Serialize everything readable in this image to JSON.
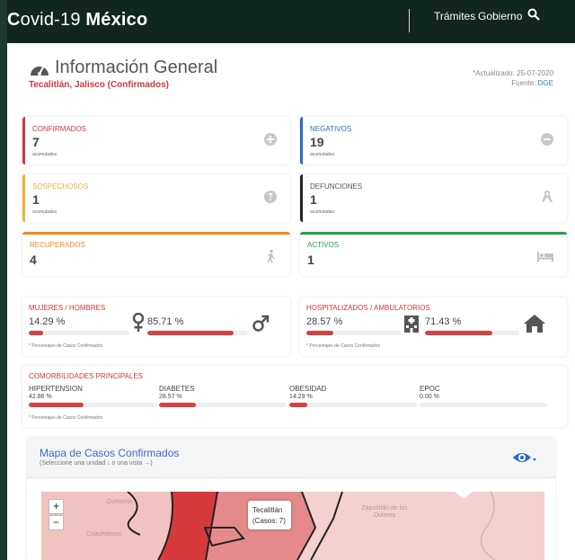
{
  "app": {
    "brand_prefix": "C",
    "brand_rest": "ovid-19 ",
    "brand_bold": "México",
    "nav": [
      "Trámites",
      "Gobierno"
    ]
  },
  "header": {
    "title": "Información General",
    "subtitle": "Tecalitlán, Jalisco (Confirmados)",
    "updated": "*Actualizado: 25-07-2020",
    "source_label": "Fuente:",
    "source_link": "DGE"
  },
  "cards": {
    "confirmados": {
      "label": "CONFIRMADOS",
      "value": "7",
      "note": "acumulados",
      "color": "#d2363b"
    },
    "negativos": {
      "label": "NEGATIVOS",
      "value": "19",
      "note": "acumulados",
      "color": "#2b6cc4"
    },
    "sospechosos": {
      "label": "SOSPECHOSOS",
      "value": "1",
      "note": "acumulados",
      "color": "#f2b13b"
    },
    "defunciones": {
      "label": "DEFUNCIONES",
      "value": "1",
      "note": "acumuladas",
      "color": "#222222"
    },
    "recuperados": {
      "label": "RECUPERADOS",
      "value": "4",
      "color": "#ef8a1f"
    },
    "activos": {
      "label": "ACTIVOS",
      "value": "1",
      "color": "#24a04a"
    }
  },
  "gender": {
    "label": "MUJERES / HOMBRES",
    "women_pct": "14.29 %",
    "men_pct": "85.71 %",
    "women_fraction": 0.1429,
    "men_fraction": 0.8571,
    "foot": "* Porcentajes  de Casos Confirmados"
  },
  "hospital": {
    "label": "HOSPITALIZADOS / AMBULATORIOS",
    "hosp_pct": "28.57 %",
    "amb_pct": "71.43 %",
    "hosp_fraction": 0.2857,
    "amb_fraction": 0.7143,
    "foot": "* Porcentajes  de Casos Confirmados"
  },
  "comorbidities": {
    "label": "COMORBILIDADES PRINCIPALES",
    "items": [
      {
        "name": "HIPERTENSION",
        "pct": "42.86 %",
        "fraction": 0.4286
      },
      {
        "name": "DIABETES",
        "pct": "28.57 %",
        "fraction": 0.2857
      },
      {
        "name": "OBESIDAD",
        "pct": "14.29 %",
        "fraction": 0.1429
      },
      {
        "name": "EPOC",
        "pct": "0.00 %",
        "fraction": 0.0
      }
    ],
    "foot": "* Porcentajes  de Casos Confirmados"
  },
  "map": {
    "title": "Mapa de Casos Confirmados",
    "hint": "(Seleccione una unidad ↓ o una vista →)",
    "zoom_in": "+",
    "zoom_out": "−",
    "tooltip_name": "Tecalitlán",
    "tooltip_count": "(Casos: 7)",
    "places": [
      "Quesería",
      "Cuauhtémoc",
      "Zapotitlán de los Dolores"
    ]
  },
  "colors": {
    "accent_red": "#d2363b",
    "topbar": "#10261f",
    "link": "#3a74c4"
  },
  "icons": [
    "search-icon",
    "gauge-icon",
    "plus-circle-icon",
    "minus-circle-icon",
    "question-circle-icon",
    "ribbon-icon",
    "walking-icon",
    "bed-icon",
    "female-icon",
    "male-icon",
    "hospital-icon",
    "home-icon",
    "eye-icon",
    "caret-down-icon"
  ]
}
